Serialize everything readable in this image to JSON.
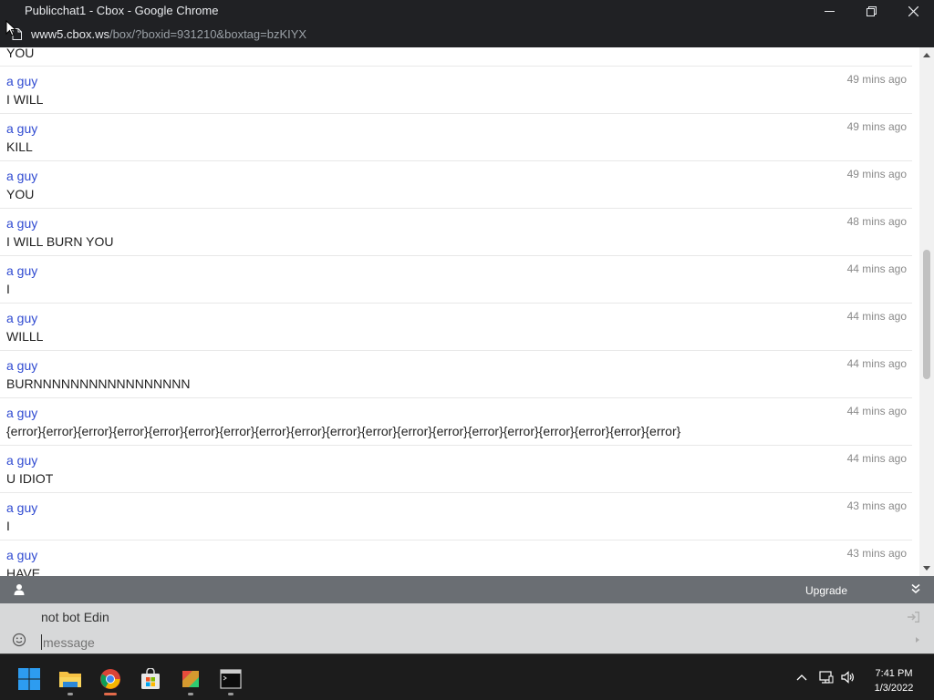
{
  "window": {
    "title": "Publicchat1 - Cbox - Google Chrome",
    "url_host": "www5.cbox.ws",
    "url_path": "/box/?boxid=931210&boxtag=bzKIYX"
  },
  "chat": {
    "top_partial_text": "YOU",
    "messages": [
      {
        "author": "a guy",
        "text": "I WILL",
        "time": "49 mins ago"
      },
      {
        "author": "a guy",
        "text": "KILL",
        "time": "49 mins ago"
      },
      {
        "author": "a guy",
        "text": "YOU",
        "time": "49 mins ago"
      },
      {
        "author": "a guy",
        "text": "I WILL BURN YOU",
        "time": "48 mins ago"
      },
      {
        "author": "a guy",
        "text": "I",
        "time": "44 mins ago"
      },
      {
        "author": "a guy",
        "text": "WILLL",
        "time": "44 mins ago"
      },
      {
        "author": "a guy",
        "text": "BURNNNNNNNNNNNNNNNNN",
        "time": "44 mins ago"
      },
      {
        "author": "a guy",
        "text": "{error}{error}{error}{error}{error}{error}{error}{error}{error}{error}{error}{error}{error}{error}{error}{error}{error}{error}{error}",
        "time": "44 mins ago"
      },
      {
        "author": "a guy",
        "text": "U IDIOT",
        "time": "44 mins ago"
      },
      {
        "author": "a guy",
        "text": "I",
        "time": "43 mins ago"
      },
      {
        "author": "a guy",
        "text": "HAVE",
        "time": "43 mins ago"
      }
    ]
  },
  "footer": {
    "upgrade_label": "Upgrade"
  },
  "input": {
    "name_value": "not bot Edin",
    "message_placeholder": "message"
  },
  "taskbar": {
    "time": "7:41 PM",
    "date": "1/3/2022"
  },
  "colors": {
    "author": "#2f4ad1",
    "footer_bar": "#6a6e73",
    "input_bg": "#d7d8d9",
    "taskbar": "#1c1c1c"
  }
}
